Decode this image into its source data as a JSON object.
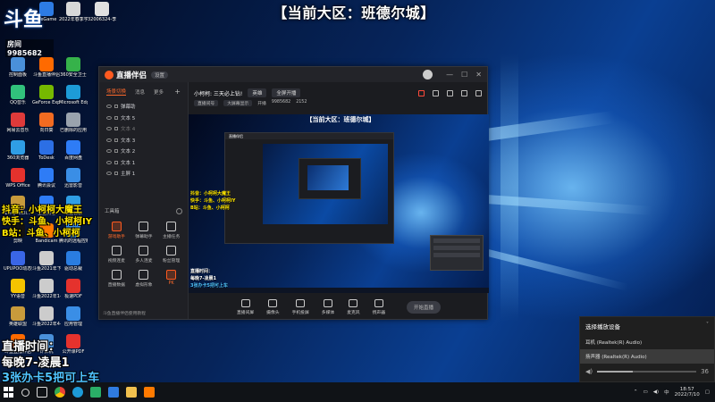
{
  "stream": {
    "banner": "【当前大区：班德尔城】",
    "logo": "斗鱼",
    "room_label": "房间",
    "room_number": "9985682",
    "overlay": {
      "douyin": "抖音：小柯柯大魔王",
      "kuaishou": "快手：斗鱼、小柯柯IY",
      "bilibili": "B站：斗鱼、小柯柯",
      "live_time_label": "直播时间：",
      "live_time_value": "每晚7-凌晨1",
      "promo": "3张办卡5把可上车"
    }
  },
  "desktop_icons": [
    {
      "label": "WeGame",
      "color": "#2d7be4"
    },
    {
      "label": "2022年春季学期期末线",
      "color": "#d8d8d8"
    },
    {
      "label": "32006324-李鸿川",
      "color": "#e0e0e0"
    },
    {
      "label": "控制面板",
      "color": "#4a90d9"
    },
    {
      "label": "斗鱼直播伴侣",
      "color": "#ff6a00"
    },
    {
      "label": "360安全卫士",
      "color": "#36b24a"
    },
    {
      "label": "QQ音乐",
      "color": "#31c27c"
    },
    {
      "label": "GeForce Experience",
      "color": "#76b900"
    },
    {
      "label": "Microsoft Edge",
      "color": "#1d9bd7"
    },
    {
      "label": "网易云音乐",
      "color": "#e03a3a"
    },
    {
      "label": "向日葵",
      "color": "#f26b21"
    },
    {
      "label": "已删除的应用",
      "color": "#9aa3ad"
    },
    {
      "label": "360浏览器",
      "color": "#2f9ee5"
    },
    {
      "label": "ToDesk",
      "color": "#2c6fe5"
    },
    {
      "label": "百度网盘",
      "color": "#2e7cf6"
    },
    {
      "label": "WPS Office",
      "color": "#e5322d"
    },
    {
      "label": "腾讯会议",
      "color": "#2e7cf6"
    },
    {
      "label": "迅雷影音",
      "color": "#3a8ee6"
    },
    {
      "label": "LeagueCli...",
      "color": "#c89b3c"
    },
    {
      "label": "企业微信",
      "color": "#2e7cf6"
    },
    {
      "label": "电脑管家",
      "color": "#2f9ee5"
    },
    {
      "label": "剪映",
      "color": "#111111"
    },
    {
      "label": "Bandicam",
      "color": "#ff7a00"
    },
    {
      "label": "腾讯的远程控制",
      "color": "#3a8ee6"
    },
    {
      "label": "UPUPOO动态壁纸",
      "color": "#3a66e6"
    },
    {
      "label": "斗鱼2021年下半年理由",
      "color": "#cccccc"
    },
    {
      "label": "驱动总裁",
      "color": "#2a7de0"
    },
    {
      "label": "YY语音",
      "color": "#f5c400"
    },
    {
      "label": "斗鱼2022年1-3月量",
      "color": "#cccccc"
    },
    {
      "label": "极速PDF",
      "color": "#e5322d"
    },
    {
      "label": "英雄联盟",
      "color": "#c89b3c"
    },
    {
      "label": "斗鱼2022年4-6月量",
      "color": "#cccccc"
    },
    {
      "label": "应用管理",
      "color": "#3a8ee6"
    },
    {
      "label": "斗鱼直播伴侣",
      "color": "#ff6a00"
    },
    {
      "label": "计算机",
      "color": "#4a90d9"
    },
    {
      "label": "公开课PDF",
      "color": "#e5322d"
    }
  ],
  "app": {
    "title": "直播伴侣",
    "badge": "设置",
    "window_controls": [
      "—",
      "☐",
      "✕"
    ],
    "side_tabs": [
      {
        "label": "场景切换",
        "active": true
      },
      {
        "label": "消息",
        "active": false
      },
      {
        "label": "更多",
        "active": false
      }
    ],
    "add_label": "+",
    "scenes": [
      {
        "label": "弹幕助",
        "dim": false
      },
      {
        "label": "文本 5",
        "dim": false
      },
      {
        "label": "文本 4",
        "dim": true
      },
      {
        "label": "文本 3",
        "dim": false
      },
      {
        "label": "文本 2",
        "dim": false
      },
      {
        "label": "文本 1",
        "dim": false
      },
      {
        "label": "主屏 1",
        "dim": false
      }
    ],
    "tools_header": "工具箱",
    "tools": [
      {
        "label": "游戏助手",
        "hot": true
      },
      {
        "label": "弹幕助手",
        "hot": false
      },
      {
        "label": "主播任务",
        "hot": false
      },
      {
        "label": "视频连麦",
        "hot": false
      },
      {
        "label": "多人连麦",
        "hot": false
      },
      {
        "label": "粉丝管理",
        "hot": false
      },
      {
        "label": "直播数据",
        "hot": false
      },
      {
        "label": "虚拟形象",
        "hot": false
      },
      {
        "label": "PK",
        "hot": true
      }
    ],
    "side_footer": "斗鱼直播伴侣使用教程",
    "room_title": "小柯柯: 三天必上钻!",
    "room_pill_1": "英雄",
    "room_pill_2": "全屏开播",
    "room_sub": [
      "直播间号",
      "大屏幕显示",
      "开播",
      "9985682",
      "2152"
    ],
    "preview_banner": "【当前大区：班德尔城】",
    "dock": [
      {
        "label": "直播间屏"
      },
      {
        "label": "摄像头"
      },
      {
        "label": "手机投屏"
      },
      {
        "label": "多媒体"
      },
      {
        "label": "麦克风"
      },
      {
        "label": "扬声器"
      }
    ],
    "start_button": "开始直播"
  },
  "sound_popup": {
    "title": "选择播放设备",
    "devices": [
      {
        "label": "耳机 (Realtek(R) Audio)",
        "selected": false
      },
      {
        "label": "扬声器 (Realtek(R) Audio)",
        "selected": true
      }
    ],
    "volume": 36,
    "volume_level": 0.36
  },
  "taskbar": {
    "time": "18:57",
    "date": "2022/7/10",
    "ime": "中"
  }
}
